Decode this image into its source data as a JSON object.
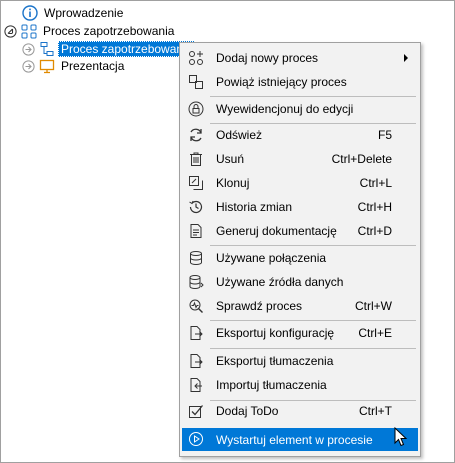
{
  "tree": {
    "items": [
      {
        "label": "Wprowadzenie",
        "icon": "info-icon"
      },
      {
        "label": "Proces zapotrzebowania",
        "icon": "process-group-icon"
      },
      {
        "label": "Proces zapotrzebowania",
        "icon": "process-icon"
      },
      {
        "label": "Prezentacja",
        "icon": "presentation-icon"
      }
    ]
  },
  "menu": {
    "items": [
      {
        "label": "Dodaj nowy proces",
        "shortcut": "",
        "icon": "add-process-icon"
      },
      {
        "label": "Powiąż istniejący proces",
        "shortcut": "",
        "icon": "link-icon"
      },
      {
        "label": "Wyewidencjonuj do edycji",
        "shortcut": "",
        "icon": "lock-icon"
      },
      {
        "label": "Odśwież",
        "shortcut": "F5",
        "icon": "refresh-icon"
      },
      {
        "label": "Usuń",
        "shortcut": "Ctrl+Delete",
        "icon": "trash-icon"
      },
      {
        "label": "Klonuj",
        "shortcut": "Ctrl+L",
        "icon": "clone-icon"
      },
      {
        "label": "Historia zmian",
        "shortcut": "Ctrl+H",
        "icon": "history-icon"
      },
      {
        "label": "Generuj dokumentację",
        "shortcut": "Ctrl+D",
        "icon": "document-icon"
      },
      {
        "label": "Używane połączenia",
        "shortcut": "",
        "icon": "database-icon"
      },
      {
        "label": "Używane źródła danych",
        "shortcut": "",
        "icon": "data-source-icon"
      },
      {
        "label": "Sprawdź proces",
        "shortcut": "Ctrl+W",
        "icon": "check-process-icon"
      },
      {
        "label": "Eksportuj konfigurację",
        "shortcut": "Ctrl+E",
        "icon": "export-config-icon"
      },
      {
        "label": "Eksportuj tłumaczenia",
        "shortcut": "",
        "icon": "export-translations-icon"
      },
      {
        "label": "Importuj tłumaczenia",
        "shortcut": "",
        "icon": "import-translations-icon"
      },
      {
        "label": "Dodaj ToDo",
        "shortcut": "Ctrl+T",
        "icon": "todo-icon"
      },
      {
        "label": "Wystartuj element w procesie",
        "shortcut": "",
        "icon": "play-icon"
      }
    ]
  }
}
